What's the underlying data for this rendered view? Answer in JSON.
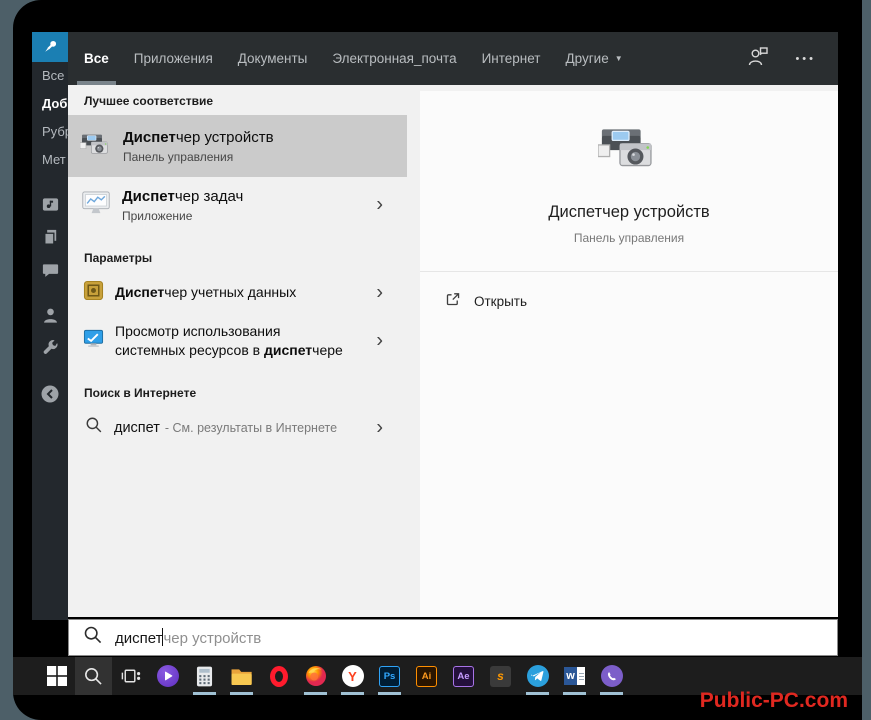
{
  "watermark": "Public-PC.com",
  "colors": {
    "accent_blue": "#1b7fb3",
    "overlay_topbar": "#2a2e30",
    "highlight_row": "#cbcbcb",
    "taskbar_indicator": "#a0c1d4",
    "watermark_red": "#e02820"
  },
  "icons": {
    "dropdown_arrow": "▼",
    "ellipsis": "•••",
    "chevron": "›"
  },
  "wp_sidebar": {
    "labels": [
      {
        "text": "Все"
      },
      {
        "text": "Доб"
      },
      {
        "text": "Рубр"
      },
      {
        "text": "Мет"
      }
    ]
  },
  "tabs": [
    {
      "label": "Все"
    },
    {
      "label": "Приложения"
    },
    {
      "label": "Документы"
    },
    {
      "label": "Электронная_почта"
    },
    {
      "label": "Интернет"
    },
    {
      "label": "Другие"
    }
  ],
  "sections": {
    "best_match": "Лучшее соответствие",
    "settings": "Параметры",
    "web": "Поиск в Интернете"
  },
  "results": {
    "device_manager": {
      "bold": "Диспет",
      "rest": "чер устройств",
      "subtitle": "Панель управления"
    },
    "task_manager": {
      "bold": "Диспет",
      "rest": "чер задач",
      "subtitle": "Приложение"
    },
    "credential_manager": {
      "bold": "Диспет",
      "rest": "чер учетных данных"
    },
    "resource_monitor": {
      "line1": "Просмотр использования",
      "line2_pre": "системных ресурсов в ",
      "line2_bold": "диспет",
      "line2_rest": "чере"
    },
    "web_search": {
      "query": "диспет",
      "hint": "- См. результаты в Интернете"
    }
  },
  "preview": {
    "title": "Диспетчер устройств",
    "subtitle": "Панель управления",
    "open": "Открыть"
  },
  "searchbox": {
    "typed": "диспет",
    "suggestion": "чер устройств"
  },
  "taskbar": {
    "apps": [
      "start",
      "search",
      "task-view",
      "alice",
      "calculator",
      "file-explorer",
      "opera",
      "firefox",
      "yandex-browser",
      "photoshop",
      "illustrator",
      "after-effects",
      "sublime-text",
      "telegram",
      "word",
      "viber"
    ],
    "glyphs": {
      "yandex": "Y",
      "ps": "Ps",
      "ai": "Ai",
      "ae": "Ae",
      "sublime": "s",
      "word": "w"
    }
  }
}
